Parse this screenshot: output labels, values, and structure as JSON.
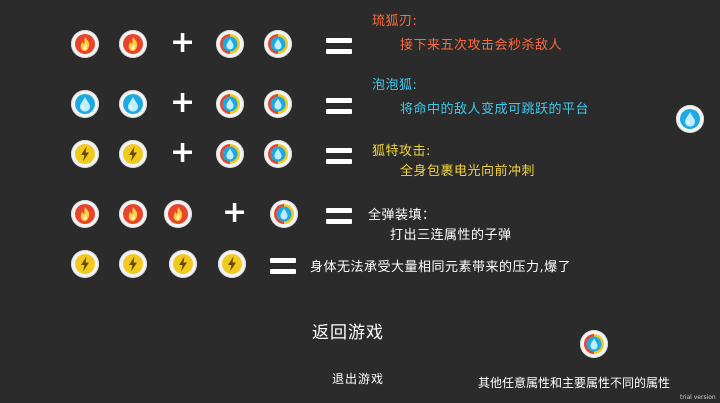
{
  "recipes": [
    {
      "title": "琉狐刃:",
      "desc": "接下来五次攻击会秒杀敌人",
      "title_color": "#ff6a3d",
      "desc_color": "#ff6a3d"
    },
    {
      "title": "泡泡狐:",
      "desc": "将命中的敌人变成可跳跃的平台",
      "title_color": "#41c8ea",
      "desc_color": "#41c8ea"
    },
    {
      "title": "狐特攻击:",
      "desc": "全身包裹电光向前冲刺",
      "title_color": "#f2d43a",
      "desc_color": "#f2d43a"
    },
    {
      "title": "全弹装填：",
      "desc": "打出三连属性的子弹",
      "title_color": "#ffffff",
      "desc_color": "#ffffff"
    },
    {
      "title": "",
      "desc": "身体无法承受大量相同元素带来的压力,爆了",
      "title_color": "#ffffff",
      "desc_color": "#ffffff"
    }
  ],
  "menu": {
    "return_game": "返回游戏",
    "exit_game": "退出游戏"
  },
  "legend": {
    "other_element": "其他任意属性和主要属性不同的属性"
  },
  "watermark": "trial version",
  "icons": {
    "fire": "fire-orb-icon",
    "water": "water-orb-icon",
    "lightning": "lightning-orb-icon",
    "mixed": "mixed-water-orb-icon"
  },
  "colors": {
    "background": "#2b2b2b",
    "fire": "#e8452c",
    "water": "#1fa9e3",
    "lightning": "#f2c91e"
  }
}
